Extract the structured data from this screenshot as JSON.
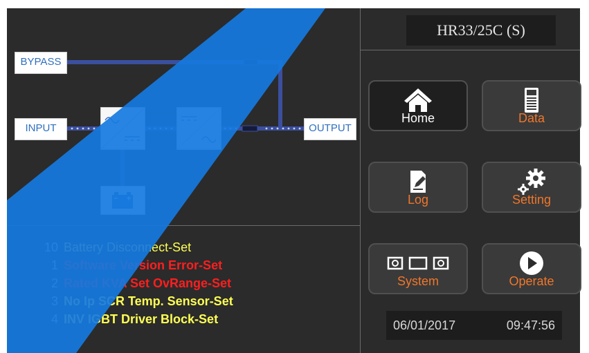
{
  "header": {
    "model": "HR33/25C  (S)"
  },
  "diagram": {
    "bypass_label": "BYPASS",
    "input_label": "INPUT",
    "output_label": "OUTPUT"
  },
  "nav": {
    "home": "Home",
    "data": "Data",
    "log": "Log",
    "setting": "Setting",
    "system": "System",
    "operate": "Operate"
  },
  "alarms": [
    {
      "num": "10",
      "text": "Battery Disconnect-Set",
      "color": "yellow"
    },
    {
      "num": "1",
      "text": "Software Version Error-Set",
      "color": "red"
    },
    {
      "num": "2",
      "text": "Rated KVA Set OvRange-Set",
      "color": "red"
    },
    {
      "num": "3",
      "text": "No Ip SCR Temp. Sensor-Set",
      "color": "yb"
    },
    {
      "num": "4",
      "text": "INV IGBT Driver Block-Set",
      "color": "yb"
    }
  ],
  "status": {
    "date": "06/01/2017",
    "time": "09:47:56"
  },
  "colors": {
    "accent": "#f0762a",
    "line": "#3b4f9e",
    "icon_blue": "#2f6fbf"
  }
}
